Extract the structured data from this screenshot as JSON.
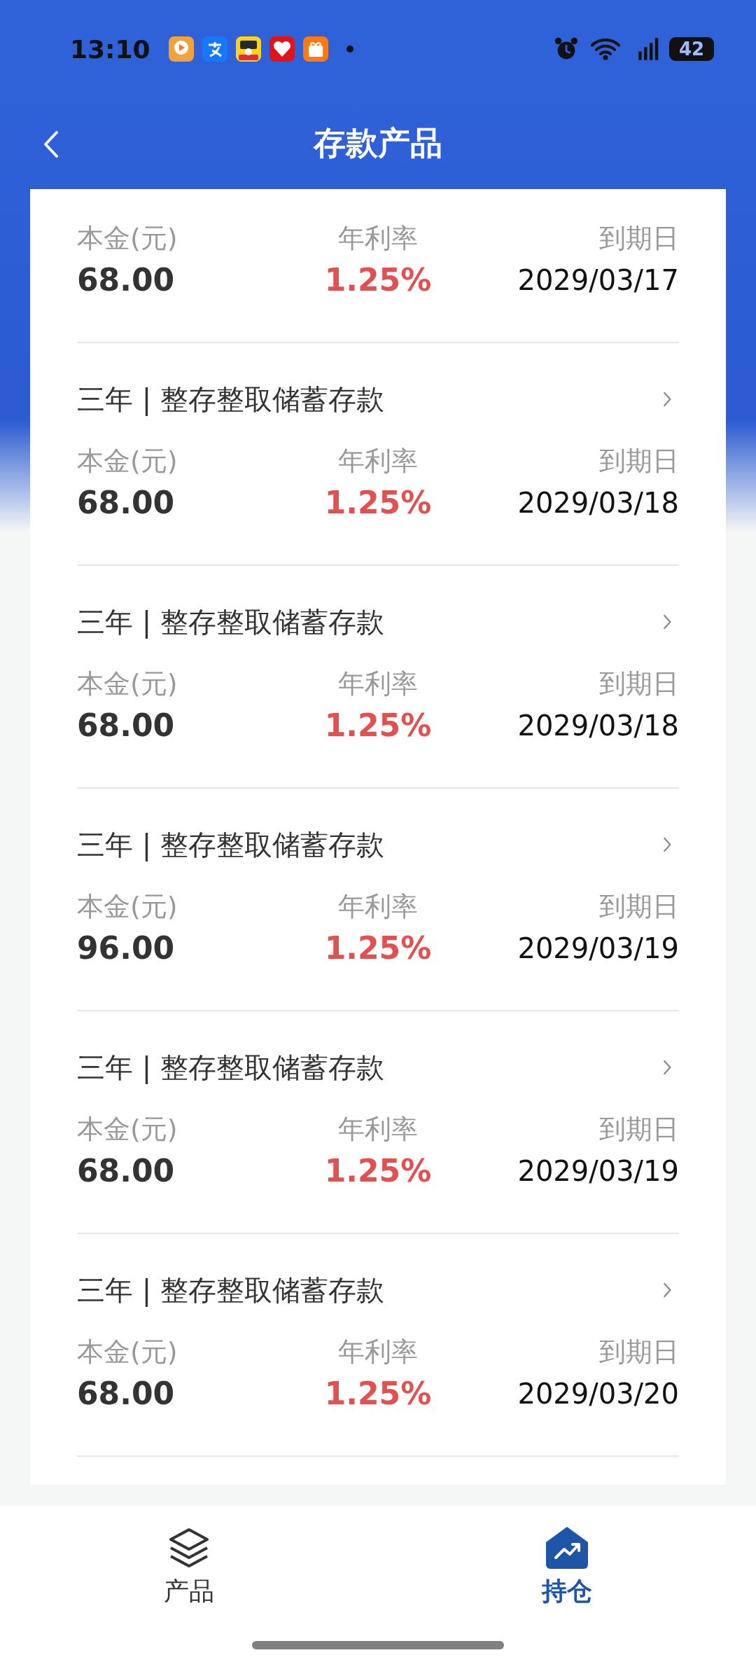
{
  "status_bar": {
    "time": "13:10",
    "battery": "42"
  },
  "header": {
    "title": "存款产品"
  },
  "deposits": [
    {
      "principal_label": "本金(元)",
      "principal": "68.00",
      "rate_label": "年利率",
      "rate": "1.25%",
      "due_label": "到期日",
      "due_date": "2029/03/17"
    },
    {
      "title": "三年 | 整存整取储蓄存款",
      "principal_label": "本金(元)",
      "principal": "68.00",
      "rate_label": "年利率",
      "rate": "1.25%",
      "due_label": "到期日",
      "due_date": "2029/03/18"
    },
    {
      "title": "三年 | 整存整取储蓄存款",
      "principal_label": "本金(元)",
      "principal": "68.00",
      "rate_label": "年利率",
      "rate": "1.25%",
      "due_label": "到期日",
      "due_date": "2029/03/18"
    },
    {
      "title": "三年 | 整存整取储蓄存款",
      "principal_label": "本金(元)",
      "principal": "96.00",
      "rate_label": "年利率",
      "rate": "1.25%",
      "due_label": "到期日",
      "due_date": "2029/03/19"
    },
    {
      "title": "三年 | 整存整取储蓄存款",
      "principal_label": "本金(元)",
      "principal": "68.00",
      "rate_label": "年利率",
      "rate": "1.25%",
      "due_label": "到期日",
      "due_date": "2029/03/19"
    },
    {
      "title": "三年 | 整存整取储蓄存款",
      "principal_label": "本金(元)",
      "principal": "68.00",
      "rate_label": "年利率",
      "rate": "1.25%",
      "due_label": "到期日",
      "due_date": "2029/03/20"
    }
  ],
  "bottom_nav": [
    {
      "kind": "products",
      "label": "产品",
      "selected": false
    },
    {
      "kind": "holdings",
      "label": "持仓",
      "selected": true
    }
  ]
}
